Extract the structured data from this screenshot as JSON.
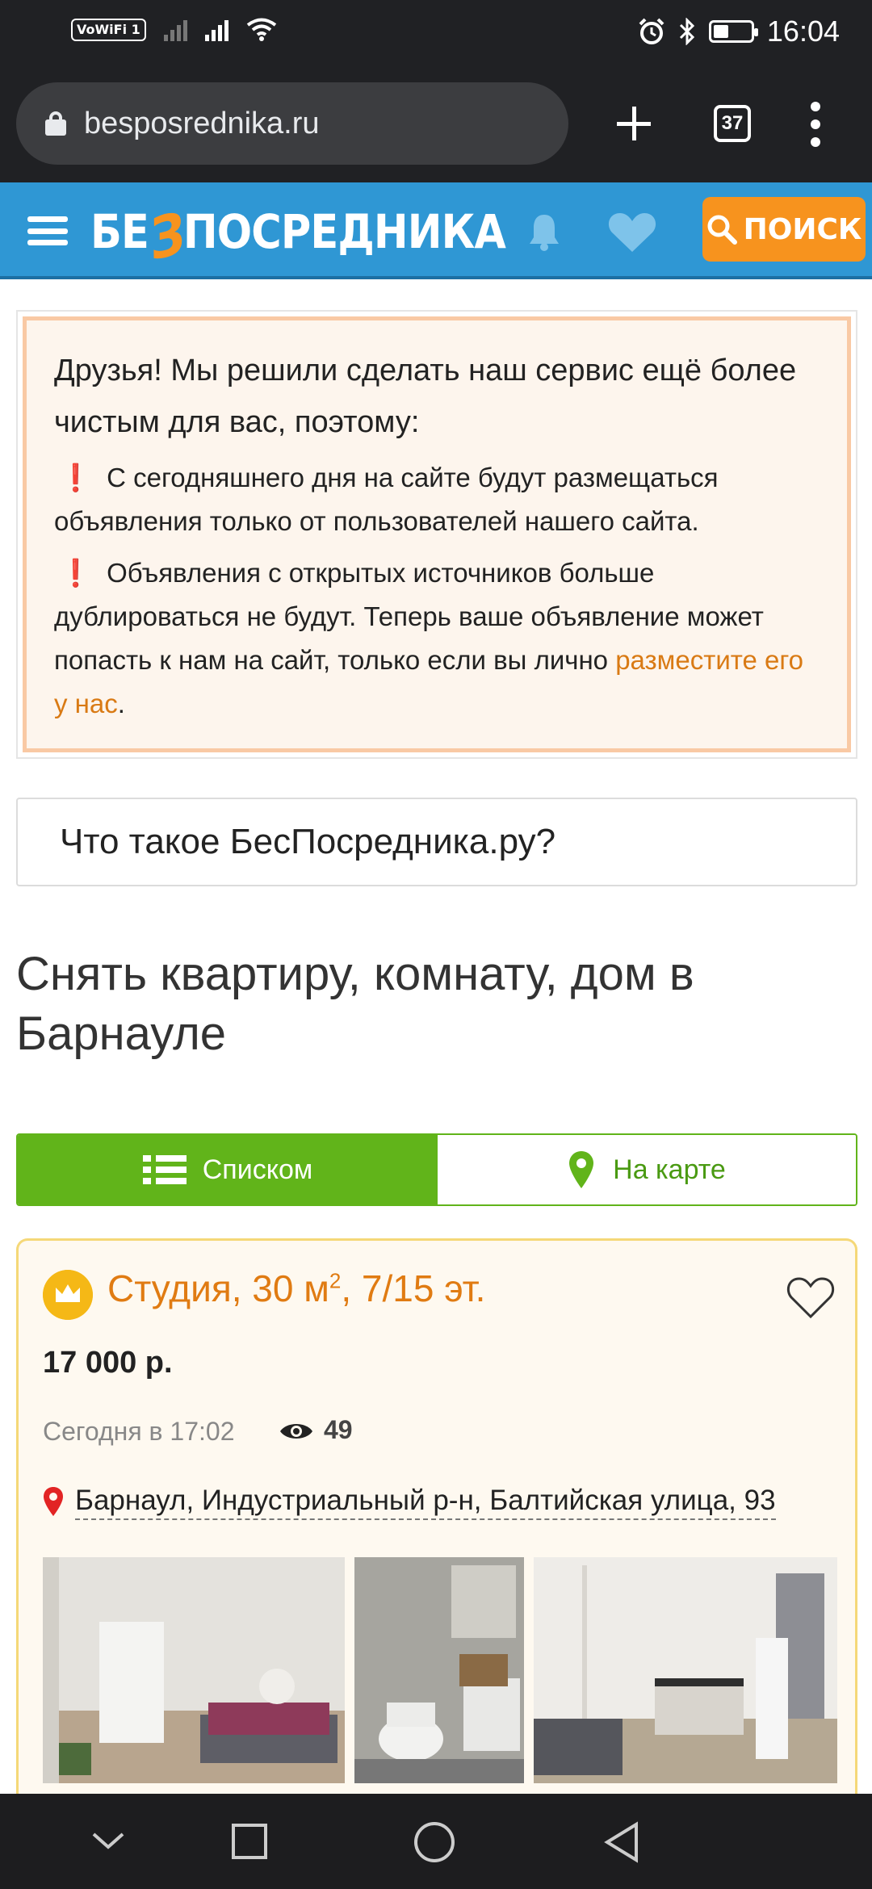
{
  "status_bar": {
    "vowifi": "VoWiFi",
    "sim": "1",
    "time": "16:04"
  },
  "browser": {
    "url": "besposrednika.ru",
    "tabs_count": "37"
  },
  "site_header": {
    "logo_part1": "БЕ",
    "logo_z": "З",
    "logo_part2": "ПОСРЕДНИКА",
    "search_label": "ПОИСК"
  },
  "notice": {
    "title": "Друзья! Мы решили сделать наш сервис ещё более чистым для вас, поэтому:",
    "item1_mark": "❗",
    "item1": "С сегодняшнего дня на сайте будут размещаться объявления только от пользователей нашего сайта.",
    "item2_mark": "❗",
    "item2": "Объявления с открытых источников больше дублироваться не будут. Теперь ваше объявление может попасть к нам на сайт, только если вы лично ",
    "item2_link": "разместите его у нас",
    "item2_end": "."
  },
  "whatis": {
    "label": "Что такое БесПосредника.ру?"
  },
  "page": {
    "title": "Снять квартиру, комнату, дом в Барнауле"
  },
  "view_toggle": {
    "list_label": "Списком",
    "map_label": "На карте",
    "active": "list"
  },
  "listing": {
    "title_main": "Студия, 30 м",
    "title_sup": "2",
    "title_rest": ", 7/15 эт.",
    "price": "17 000 р.",
    "date": "Сегодня в 17:02",
    "views": "49",
    "address": "Барнаул, Индустриальный р-н, Балтийская улица, 93",
    "photos": [
      "living-room-photo",
      "bathroom-photo",
      "kitchen-photo"
    ]
  },
  "colors": {
    "header_blue": "#2f97d4",
    "accent_orange": "#f7931e",
    "toggle_green": "#61b41a",
    "title_orange": "#e07b12"
  }
}
